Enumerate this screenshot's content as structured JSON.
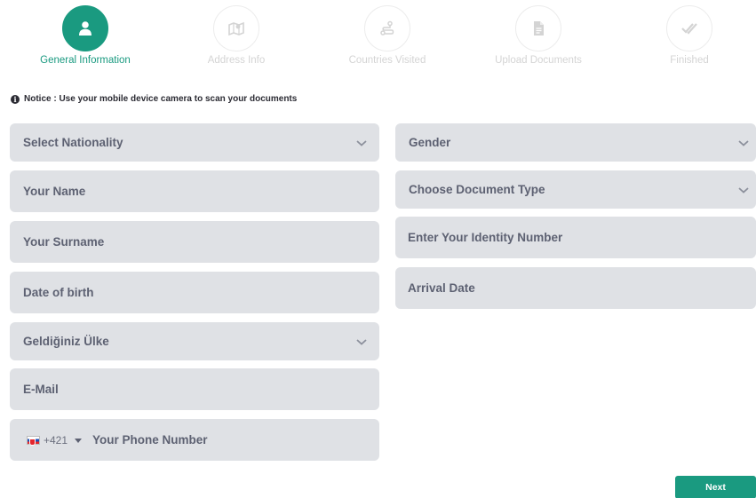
{
  "stepper": {
    "steps": [
      {
        "label": "General Information",
        "icon": "user-icon",
        "active": true
      },
      {
        "label": "Address Info",
        "icon": "map-icon",
        "active": false
      },
      {
        "label": "Countries Visited",
        "icon": "route-icon",
        "active": false
      },
      {
        "label": "Upload Documents",
        "icon": "document-icon",
        "active": false
      },
      {
        "label": "Finished",
        "icon": "double-check-icon",
        "active": false
      }
    ]
  },
  "notice": {
    "text": "Notice : Use your mobile device camera to scan your documents",
    "icon": "info-icon"
  },
  "form": {
    "left": {
      "nationality": "Select Nationality",
      "name": "Your Name",
      "surname": "Your Surname",
      "dob": "Date of birth",
      "origin_country": "Geldiğiniz Ülke",
      "email": "E-Mail",
      "phone": {
        "flag": "slovakia-flag-icon",
        "dial_code": "+421",
        "placeholder": "Your Phone Number"
      }
    },
    "right": {
      "gender": "Gender",
      "document_type": "Choose Document Type",
      "identity_number": "Enter Your Identity Number",
      "arrival_date": "Arrival Date"
    }
  },
  "actions": {
    "next_label": "Next"
  },
  "colors": {
    "accent": "#1a9a80",
    "field_bg": "#dfe1e5",
    "field_text": "#5d6172",
    "inactive_step": "#d4d4d4"
  }
}
